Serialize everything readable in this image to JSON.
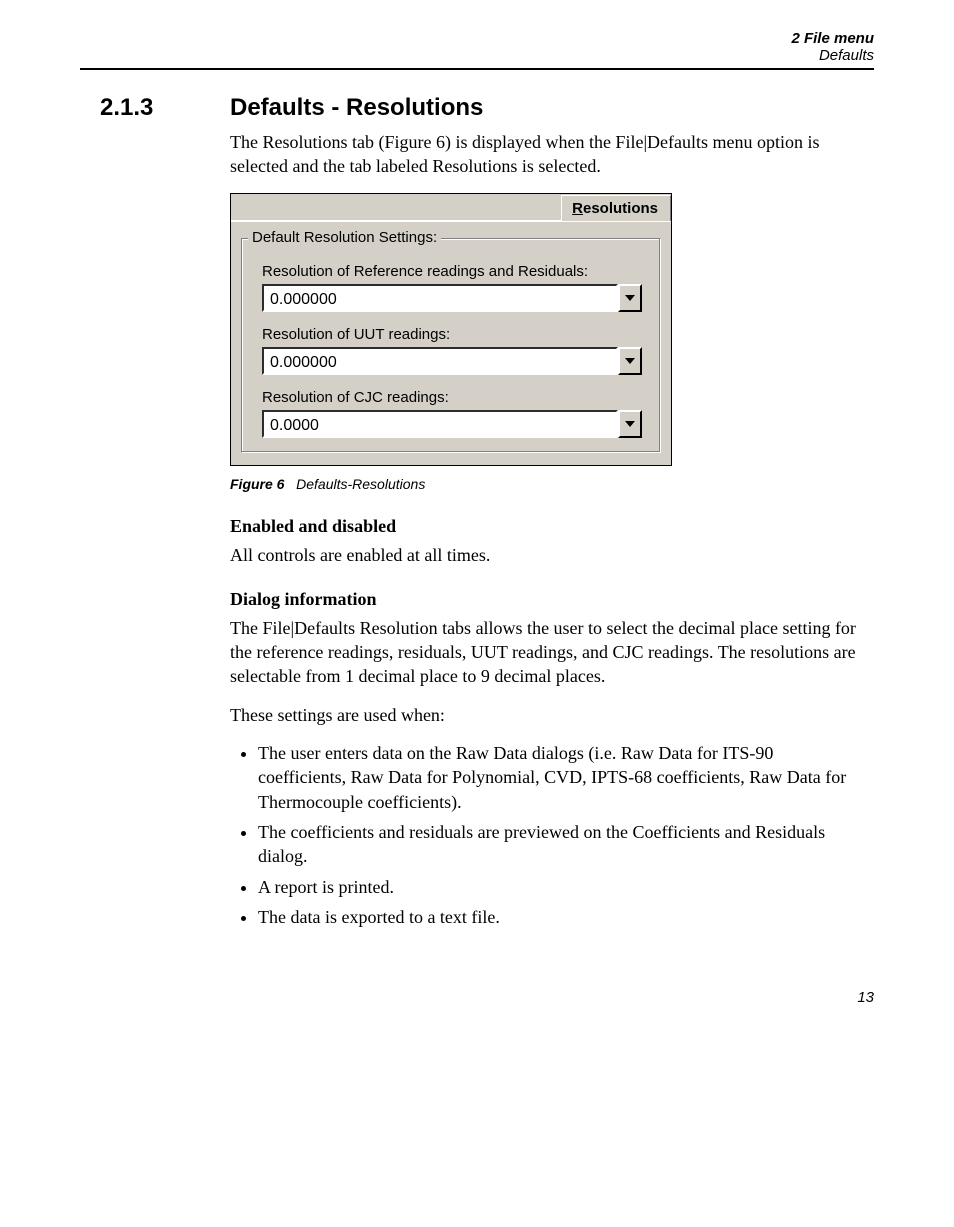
{
  "header": {
    "line1": "2  File menu",
    "line2": "Defaults"
  },
  "section": {
    "number": "2.1.3",
    "title": "Defaults - Resolutions"
  },
  "intro": "The Resolutions tab (Figure 6) is displayed when the File|Defaults menu option is selected and the tab labeled Resolutions is selected.",
  "dialog": {
    "tab_underline_letter": "R",
    "tab_rest": "esolutions",
    "group_title": "Default Resolution Settings:",
    "fields": [
      {
        "label": "Resolution of Reference readings and Residuals:",
        "value": "0.000000"
      },
      {
        "label": "Resolution of UUT readings:",
        "value": "0.000000"
      },
      {
        "label": "Resolution of CJC readings:",
        "value": "0.0000"
      }
    ]
  },
  "figure_caption": {
    "bold": "Figure 6",
    "rest": "Defaults-Resolutions"
  },
  "enabled_heading": "Enabled and disabled",
  "enabled_text": "All controls are enabled at all times.",
  "dialoginfo_heading": "Dialog information",
  "dialoginfo_text": "The File|Defaults Resolution tabs allows the user to select the decimal place setting for the reference readings, residuals, UUT readings, and CJC readings. The resolutions are selectable from 1 decimal place to 9 decimal places.",
  "settings_lead": "These settings are used when:",
  "bullets": [
    "The user enters data on the Raw Data dialogs (i.e. Raw Data for ITS-90 coefficients, Raw Data for Polynomial, CVD, IPTS-68 coefficients, Raw Data for Thermocouple coefficients).",
    "The coefficients and residuals are previewed on the Coefficients and Residuals dialog.",
    "A report is printed.",
    "The data is exported to a text file."
  ],
  "page_number": "13"
}
